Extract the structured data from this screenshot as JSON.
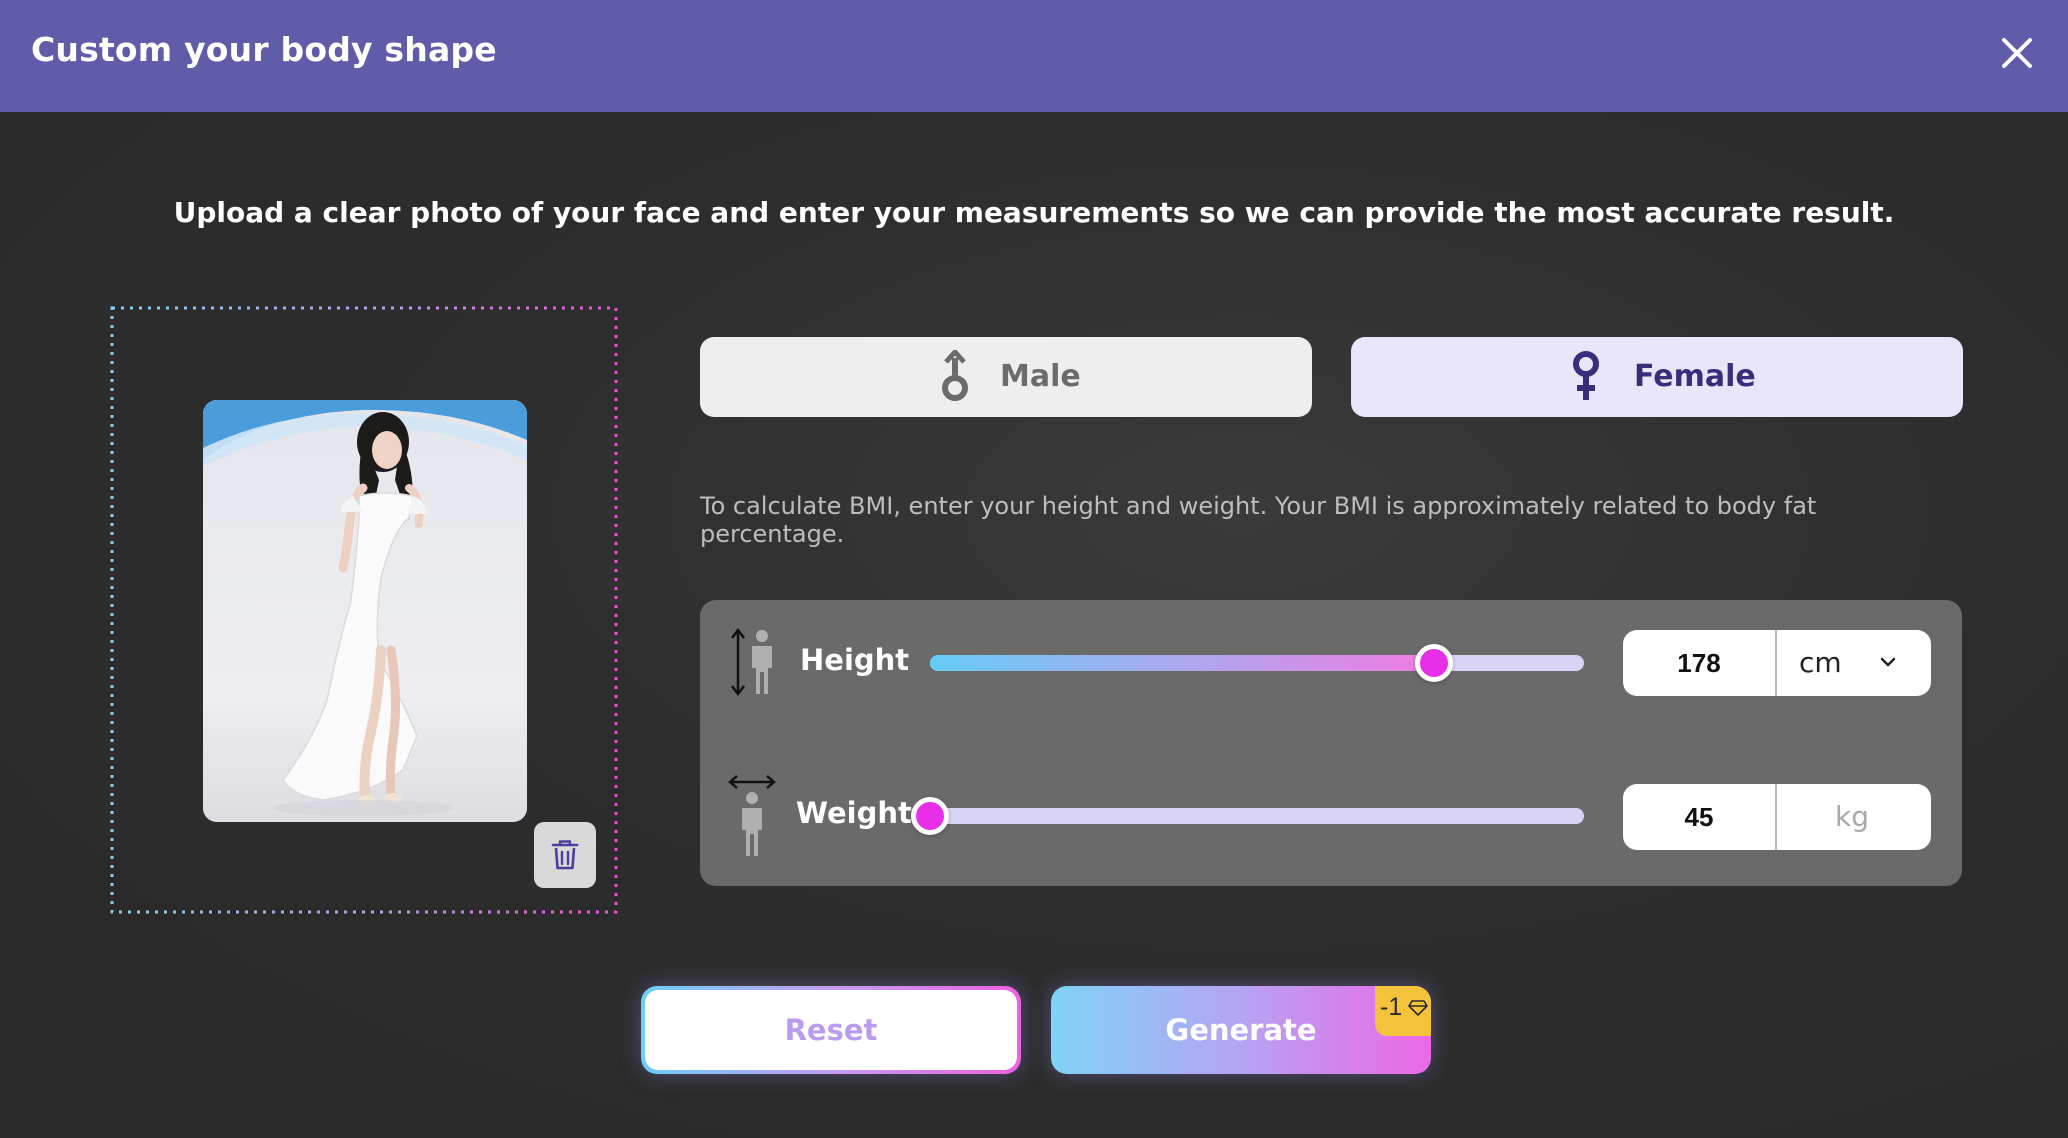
{
  "header": {
    "title": "Custom your body shape",
    "close_icon": "close-icon",
    "background": "#605ca8"
  },
  "intro_text": "Upload a clear photo of your face and enter your measurements so we can provide the most accurate result.",
  "upload": {
    "photo_description": "uploaded-photo",
    "delete_icon": "trash-icon"
  },
  "gender": {
    "options": [
      {
        "label": "Male",
        "icon": "male-symbol-icon",
        "selected": false
      },
      {
        "label": "Female",
        "icon": "female-symbol-icon",
        "selected": true
      }
    ]
  },
  "bmi_hint": "To calculate BMI, enter your height and weight. Your BMI is approximately related to body fat percentage.",
  "measurements": {
    "height": {
      "label": "Height",
      "value": "178",
      "unit": "cm",
      "slider_fraction": 0.77,
      "icon": "height-person-icon"
    },
    "weight": {
      "label": "Weight",
      "value": "45",
      "unit": "kg",
      "slider_fraction": 0.0,
      "icon": "weight-person-icon"
    }
  },
  "actions": {
    "reset_label": "Reset",
    "generate_label": "Generate",
    "generate_cost": "-1",
    "cost_icon": "diamond-icon"
  },
  "colors": {
    "accent_purple": "#605ca8",
    "thumb_magenta": "#e62fe6",
    "badge_yellow": "#f5c33b",
    "female_selected_bg": "#e9e6fb",
    "female_text": "#3a2d79"
  }
}
